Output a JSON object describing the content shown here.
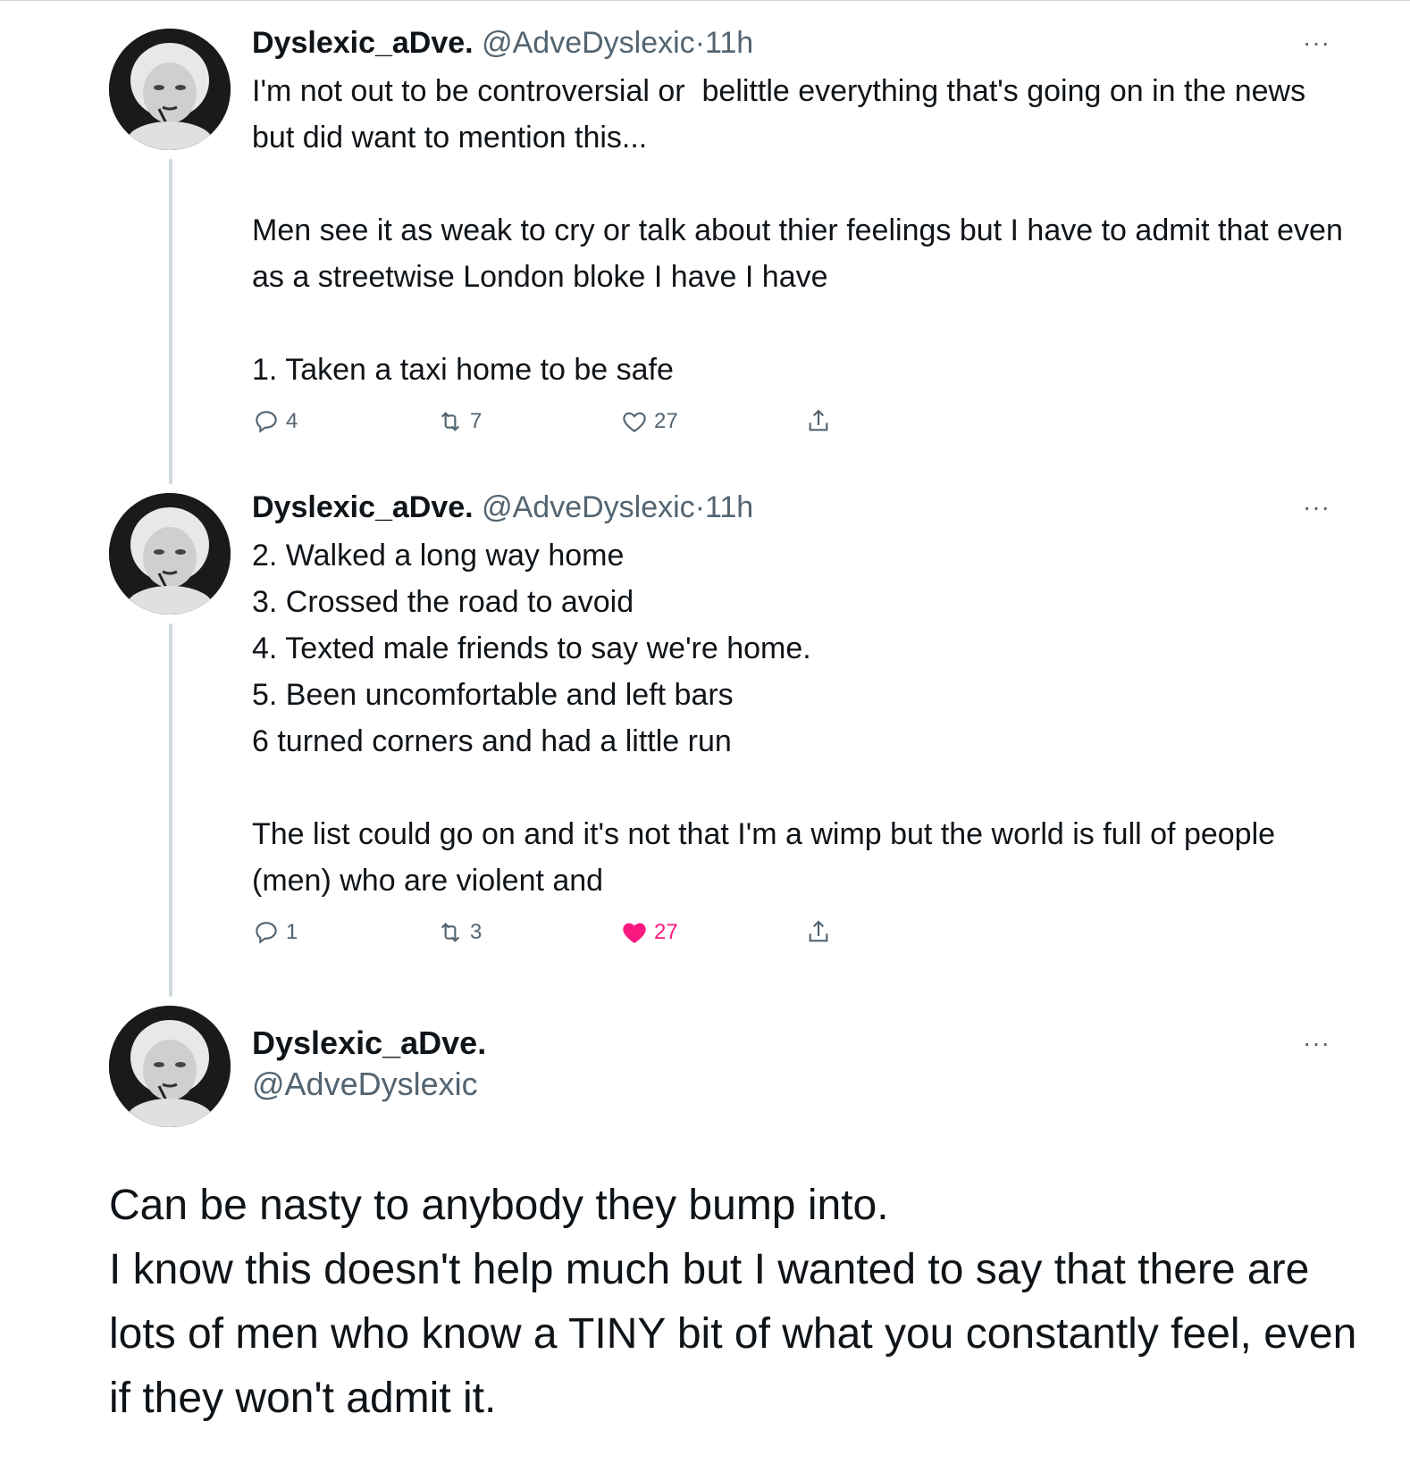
{
  "tweets": [
    {
      "name": "Dyslexic_aDve.",
      "handle": "@AdveDyslexic",
      "separator": "·",
      "time": "11h",
      "text": "I'm not out to be controversial or  belittle everything that's going on in the news but did want to mention this...\n\nMen see it as weak to cry or talk about thier feelings but I have to admit that even as a streetwise London bloke I have I have\n\n1. Taken a taxi home to be safe",
      "replies": "4",
      "retweets": "7",
      "likes": "27",
      "liked": false
    },
    {
      "name": "Dyslexic_aDve.",
      "handle": "@AdveDyslexic",
      "separator": "·",
      "time": "11h",
      "text": "2. Walked a long way home\n3. Crossed the road to avoid\n4. Texted male friends to say we're home.\n5. Been uncomfortable and left bars\n6 turned corners and had a little run\n\nThe list could go on and it's not that I'm a wimp but the world is full of people (men) who are violent and",
      "replies": "1",
      "retweets": "3",
      "likes": "27",
      "liked": true
    }
  ],
  "focused": {
    "name": "Dyslexic_aDve.",
    "handle": "@AdveDyslexic",
    "text": "Can be nasty to anybody they bump into.\nI know this doesn't help much but I wanted to say that there are lots of men who know a TINY bit of what you constantly feel, even if they won't admit it."
  },
  "more_label": "···",
  "icons": [
    "reply-icon",
    "retweet-icon",
    "like-icon",
    "share-icon",
    "more-icon",
    "avatar"
  ],
  "colors": {
    "secondary_text": "#536471",
    "like_active": "#f91880",
    "thread_line": "#cfd9de"
  }
}
